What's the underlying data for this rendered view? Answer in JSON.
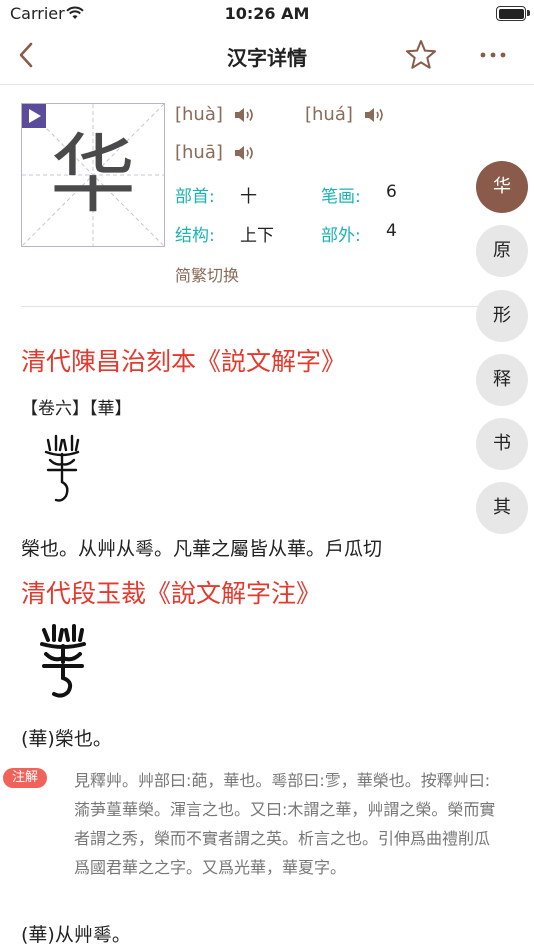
{
  "status_bar": {
    "carrier": "Carrier",
    "time": "10:26 AM"
  },
  "nav": {
    "title": "汉字详情"
  },
  "char": {
    "glyph": "华"
  },
  "readings": [
    "[huà]",
    "[huá]",
    "[huā]"
  ],
  "info": {
    "radical_label": "部首:",
    "radical_value": "十",
    "strokes_label": "笔画:",
    "strokes_value": "6",
    "structure_label": "结构:",
    "structure_value": "上下",
    "outside_label": "部外:",
    "outside_value": "4",
    "switch_label": "简繁切换"
  },
  "side_tabs": [
    "华",
    "原",
    "形",
    "释",
    "书",
    "其"
  ],
  "section1": {
    "title": "清代陳昌治刻本《説文解字》",
    "volume": "【卷六】【華】",
    "definition": "榮也。从艸从𠌶。凡華之屬皆从華。戶瓜切"
  },
  "section2": {
    "title": "清代段玉裁《說文解字注》",
    "line1": "(華)榮也。",
    "note_badge": "注解",
    "note": "見釋艸。艸部曰:葩，華也。𠌶部曰:𩁺，華榮也。按釋艸曰:蕍芛葟華榮。渾言之也。又曰:木謂之華，艸謂之榮。榮而實者謂之秀，榮而不實者謂之英。析言之也。引伸爲曲禮削瓜爲國君華之之字。又爲光華，華夏字。",
    "line2": "(華)从艸𠌶。"
  },
  "colors": {
    "accent_brown": "#8a5a4a",
    "title_red": "#e5392e",
    "label_teal": "#1bb3b0",
    "badge_red": "#f0625a"
  }
}
